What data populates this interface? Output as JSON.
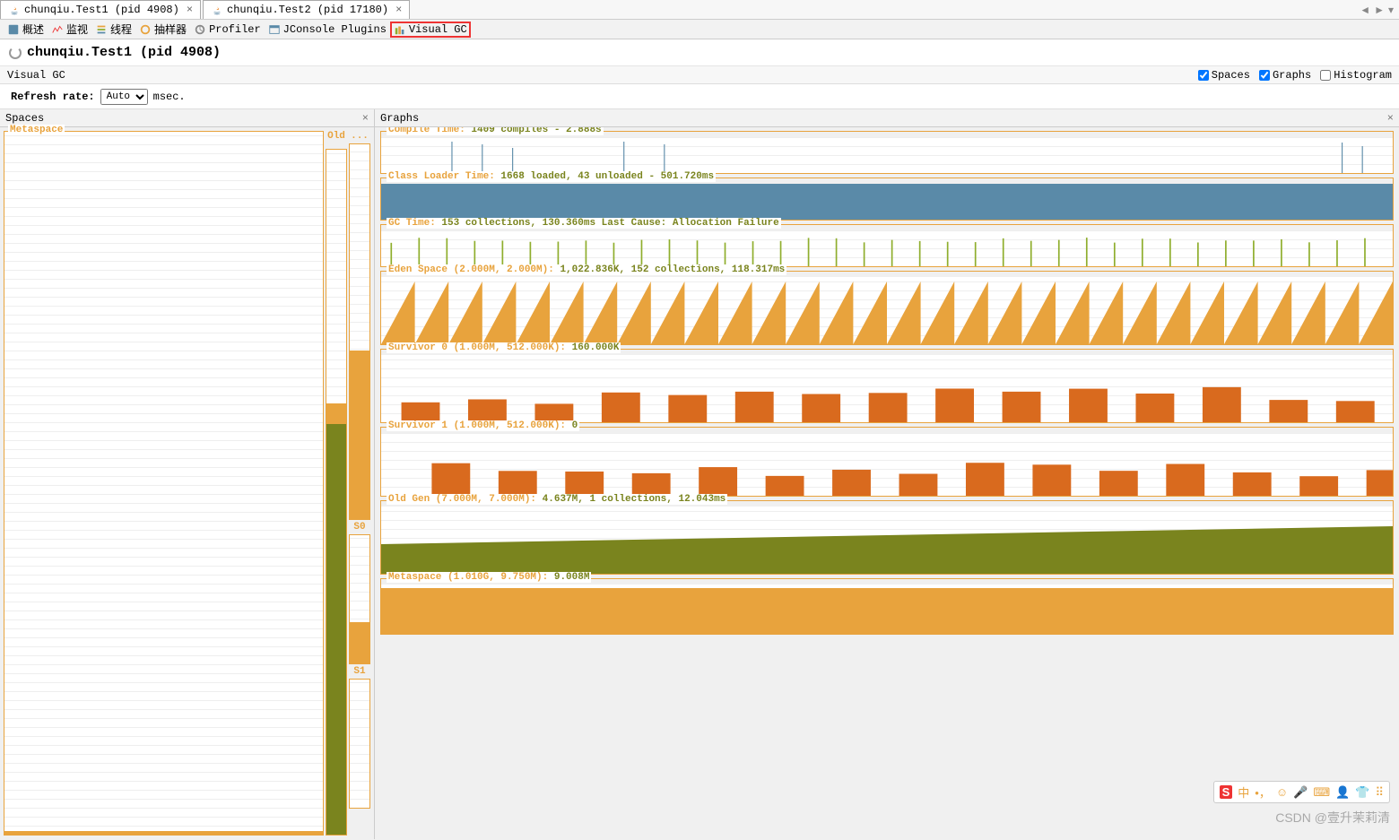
{
  "tabs": [
    {
      "label": "chunqiu.Test1 (pid 4908)",
      "active": true
    },
    {
      "label": "chunqiu.Test2 (pid 17180)",
      "active": false
    }
  ],
  "toolbar": {
    "overview": "概述",
    "monitor": "监视",
    "threads": "线程",
    "sampler": "抽样器",
    "profiler": "Profiler",
    "jconsole": "JConsole Plugins",
    "visualgc": "Visual GC"
  },
  "header": {
    "title": "chunqiu.Test1 (pid 4908)"
  },
  "subbar": {
    "title": "Visual GC",
    "checks": {
      "spaces": "Spaces",
      "graphs": "Graphs",
      "histogram": "Histogram"
    },
    "checked": {
      "spaces": true,
      "graphs": true,
      "histogram": false
    }
  },
  "refresh": {
    "label": "Refresh rate:",
    "value": "Auto",
    "unit": "msec."
  },
  "panels": {
    "spaces": "Spaces",
    "graphs": "Graphs"
  },
  "spaces": {
    "metaspace": "Metaspace",
    "old": "Old",
    "eden_dots": "...",
    "s0": "S0",
    "s1": "S1"
  },
  "graphs": {
    "compile": {
      "t1": "Compile Time: ",
      "t2": "1409 compiles - 2.888s"
    },
    "classloader": {
      "t1": "Class Loader Time: ",
      "t2": "1668 loaded, 43 unloaded - 501.720ms"
    },
    "gctime": {
      "t1": "GC Time: ",
      "t2": "153 collections, 130.360ms Last Cause: Allocation Failure"
    },
    "eden": {
      "t1": "Eden Space (2.000M, 2.000M): ",
      "t2": "1,022.836K, 152 collections, 118.317ms"
    },
    "s0": {
      "t1": "Survivor 0 (1.000M, 512.000K): ",
      "t2": "160.000K"
    },
    "s1": {
      "t1": "Survivor 1 (1.000M, 512.000K): ",
      "t2": "0"
    },
    "oldgen": {
      "t1": "Old Gen (7.000M, 7.000M): ",
      "t2": "4.637M, 1 collections, 12.043ms"
    },
    "metaspace": {
      "t1": "Metaspace (1.010G, 9.750M): ",
      "t2": "9.008M"
    }
  },
  "watermark": "CSDN @壹升茉莉清",
  "ime": {
    "logo": "S",
    "mode": "中"
  },
  "chart_data": [
    {
      "name": "compile_time",
      "type": "line",
      "title": "Compile Time: 1409 compiles - 2.888s",
      "spikes_at_pct": [
        7,
        10,
        13,
        24,
        28,
        95,
        97
      ]
    },
    {
      "name": "class_loader",
      "type": "area",
      "title": "Class Loader Time: 1668 loaded, 43 unloaded - 501.720ms",
      "fill_pct": 100,
      "color": "#5a8aa8"
    },
    {
      "name": "gc_time",
      "type": "line",
      "title": "GC Time: 153 collections, 130.360ms",
      "cause": "Allocation Failure",
      "spike_count": 36,
      "color": "#8fae2d"
    },
    {
      "name": "eden_space",
      "type": "area",
      "title": "Eden Space (2.000M, 2.000M): 1,022.836K",
      "collections": 152,
      "time_ms": 118.317,
      "sawtooth_cycles": 30,
      "color": "#e8a33d"
    },
    {
      "name": "survivor_0",
      "type": "bar",
      "title": "Survivor 0 (1.000M, 512.000K): 160.000K",
      "bars": 15,
      "avg_pct": 45,
      "color": "#d96a1e"
    },
    {
      "name": "survivor_1",
      "type": "bar",
      "title": "Survivor 1 (1.000M, 512.000K): 0",
      "bars": 15,
      "avg_pct": 40,
      "color": "#d96a1e"
    },
    {
      "name": "old_gen",
      "type": "area",
      "title": "Old Gen (7.000M, 7.000M): 4.637M",
      "collections": 1,
      "time_ms": 12.043,
      "slope_start_pct": 55,
      "slope_end_pct": 70,
      "color": "#7a841e"
    },
    {
      "name": "metaspace",
      "type": "area",
      "title": "Metaspace (1.010G, 9.750M): 9.008M",
      "fill_pct": 92,
      "color": "#e8a33d"
    }
  ]
}
